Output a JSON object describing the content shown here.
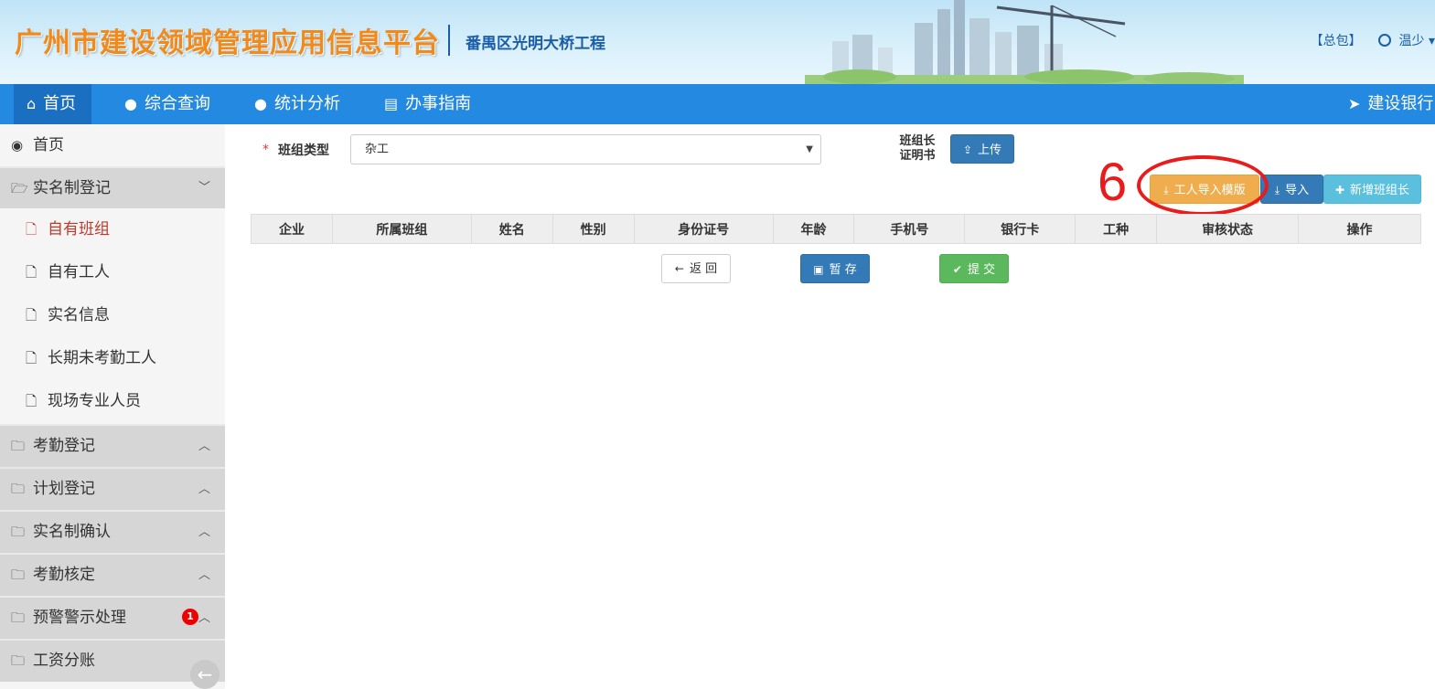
{
  "header": {
    "title": "广州市建设领域管理应用信息平台",
    "project": "番禺区光明大桥工程",
    "role": "【总包】",
    "user": "温少"
  },
  "nav": {
    "items": [
      {
        "label": "首页",
        "icon": "home-icon"
      },
      {
        "label": "综合查询",
        "icon": "globe-icon"
      },
      {
        "label": "统计分析",
        "icon": "globe-icon"
      },
      {
        "label": "办事指南",
        "icon": "book-icon"
      },
      {
        "label": "建设银行",
        "icon": "paper-plane-icon"
      }
    ]
  },
  "sidebar": {
    "home": "首页",
    "groups": [
      {
        "label": "实名制登记",
        "expanded": true
      },
      {
        "label": "考勤登记"
      },
      {
        "label": "计划登记"
      },
      {
        "label": "实名制确认"
      },
      {
        "label": "考勤核定"
      },
      {
        "label": "预警警示处理",
        "badge": "1"
      },
      {
        "label": "工资分账"
      }
    ],
    "sub_items": [
      "自有班组",
      "自有工人",
      "实名信息",
      "长期未考勤工人",
      "现场专业人员"
    ]
  },
  "form": {
    "required_mark": "*",
    "type_label": "班组类型",
    "type_value": "杂工",
    "cert_label_line1": "班组长",
    "cert_label_line2": "证明书",
    "upload_button": "上传"
  },
  "actions": {
    "template_button": "工人导入模版",
    "import_button": "导入",
    "add_leader_button": "新增班组长"
  },
  "annotation": {
    "number": "6"
  },
  "table": {
    "columns": [
      "企业",
      "所属班组",
      "姓名",
      "性别",
      "身份证号",
      "年龄",
      "手机号",
      "银行卡",
      "工种",
      "审核状态",
      "操作"
    ]
  },
  "footer_buttons": {
    "back": "返 回",
    "save": "暂 存",
    "submit": "提 交"
  },
  "colors": {
    "nav_bg": "#2489e0",
    "brand_orange": "#f08a1c",
    "annotation_red": "#e81c1c",
    "warning_button": "#f0ad4e",
    "primary_button": "#337ab7",
    "info_button": "#5bc0de",
    "success_button": "#5cb85c"
  }
}
